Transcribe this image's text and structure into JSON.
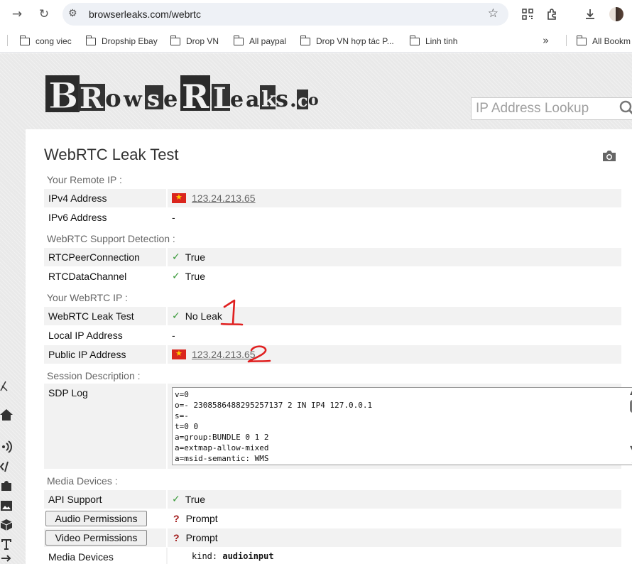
{
  "browser": {
    "url": "browserleaks.com/webrtc",
    "bookmarks": [
      "cong viec",
      "Dropship Ebay",
      "Drop VN",
      "All paypal",
      "Drop VN hợp tác P...",
      "Linh tinh"
    ],
    "more_glyph": "»",
    "all_bookmarks": "All Bookm"
  },
  "site": {
    "search_placeholder": "IP Address Lookup"
  },
  "page": {
    "title": "WebRTC Leak Test",
    "sections": {
      "remote_ip": "Your Remote IP :",
      "support": "WebRTC Support Detection :",
      "webrtc_ip": "Your WebRTC IP :",
      "session": "Session Description :",
      "media": "Media Devices :"
    },
    "remote": {
      "ipv4_label": "IPv4 Address",
      "ipv4_value": "123.24.213.65",
      "ipv6_label": "IPv6 Address",
      "ipv6_value": "-"
    },
    "support": {
      "peer_label": "RTCPeerConnection",
      "peer_value": "True",
      "channel_label": "RTCDataChannel",
      "channel_value": "True"
    },
    "webrtc": {
      "leak_label": "WebRTC Leak Test",
      "leak_value": "No Leak",
      "local_label": "Local IP Address",
      "local_value": "-",
      "public_label": "Public IP Address",
      "public_value": "123.24.213.65"
    },
    "sdp": {
      "label": "SDP Log",
      "lines": [
        "v=0",
        "o=- 2308586488295257137 2 IN IP4 127.0.0.1",
        "s=-",
        "t=0 0",
        "a=group:BUNDLE 0 1 2",
        "a=extmap-allow-mixed",
        "a=msid-semantic: WMS"
      ]
    },
    "media": {
      "api_label": "API Support",
      "api_value": "True",
      "audio_btn": "Audio Permissions",
      "audio_value": "Prompt",
      "video_btn": "Video Permissions",
      "video_value": "Prompt",
      "devices_label": "Media Devices",
      "devices_key": "kind:",
      "devices_value": "audioinput"
    }
  },
  "annotations": {
    "mark1": "1",
    "mark2": "2",
    "color": "#e02020"
  }
}
